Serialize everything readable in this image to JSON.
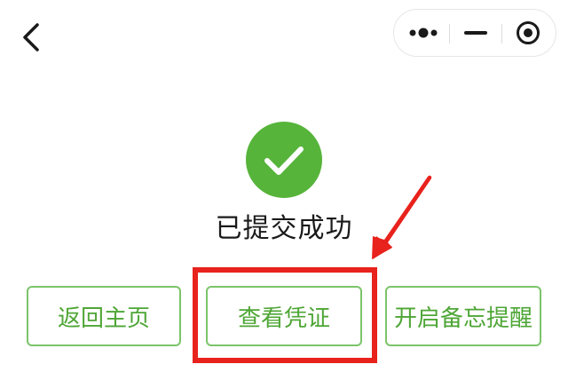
{
  "nav": {
    "back_icon": "chevron-left-icon",
    "capsule": {
      "more_icon": "more-dots-icon",
      "minimize_icon": "minimize-icon",
      "close_icon": "target-close-icon"
    }
  },
  "result": {
    "icon": "check-circle-icon",
    "title": "已提交成功"
  },
  "actions": {
    "home_label": "返回主页",
    "voucher_label": "查看凭证",
    "reminder_label": "开启备忘提醒"
  },
  "colors": {
    "success_green": "#56b43a",
    "button_border": "#7bc46a",
    "button_text": "#4ea636",
    "annotation_red": "#e8221c"
  }
}
